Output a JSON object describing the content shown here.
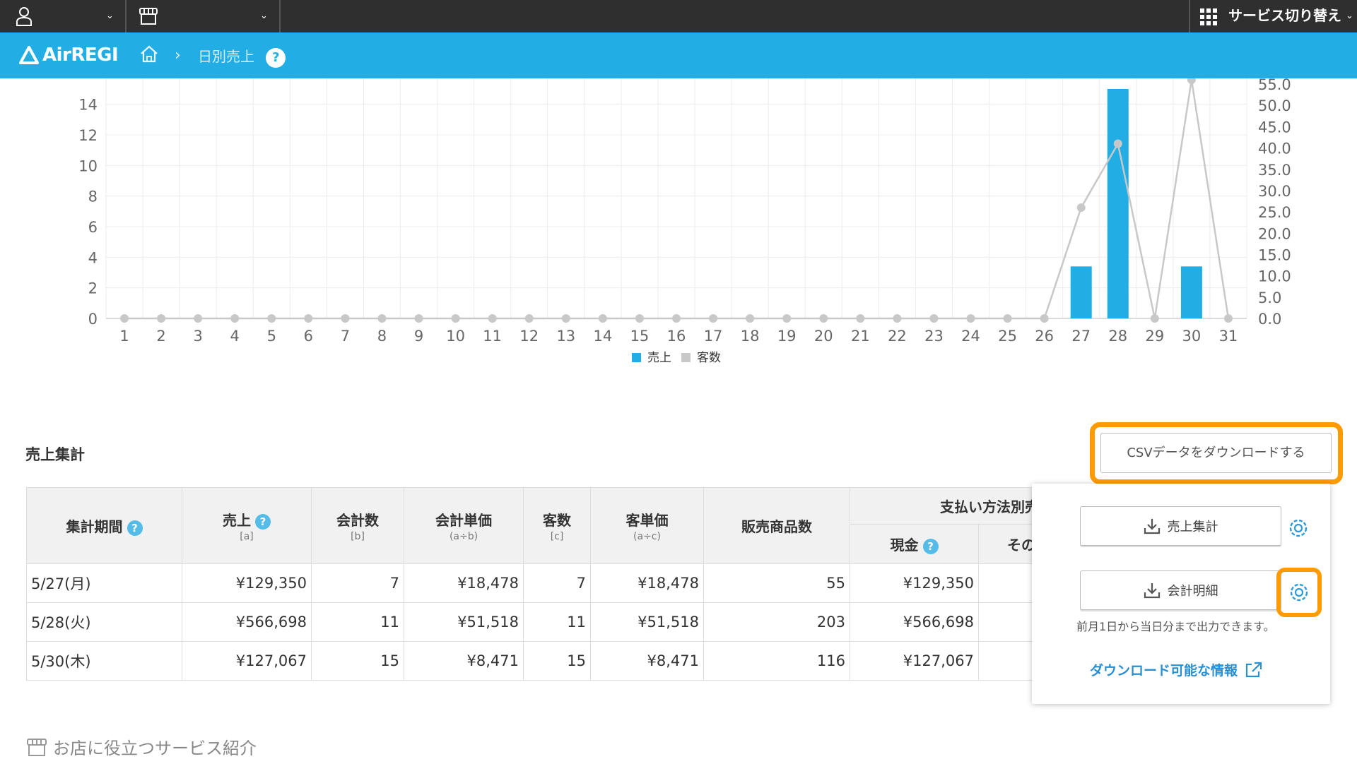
{
  "topbar": {
    "service_switch_label": "サービス切り替え"
  },
  "header": {
    "logo_text": "AirREGI",
    "breadcrumb_current": "日別売上",
    "help_mark": "?"
  },
  "chart_data": {
    "type": "bar",
    "categories": [
      "1",
      "2",
      "3",
      "4",
      "5",
      "6",
      "7",
      "8",
      "9",
      "10",
      "11",
      "12",
      "13",
      "14",
      "15",
      "16",
      "17",
      "18",
      "19",
      "20",
      "21",
      "22",
      "23",
      "24",
      "25",
      "26",
      "27",
      "28",
      "29",
      "30",
      "31"
    ],
    "series": [
      {
        "name": "売上",
        "kind": "bar",
        "axis": "left",
        "color": "#22aee4",
        "values": [
          0,
          0,
          0,
          0,
          0,
          0,
          0,
          0,
          0,
          0,
          0,
          0,
          0,
          0,
          0,
          0,
          0,
          0,
          0,
          0,
          0,
          0,
          0,
          0,
          0,
          0,
          3.4,
          15,
          0,
          3.4,
          0
        ]
      },
      {
        "name": "客数",
        "kind": "line",
        "axis": "right",
        "color": "#c8c8c8",
        "values": [
          0,
          0,
          0,
          0,
          0,
          0,
          0,
          0,
          0,
          0,
          0,
          0,
          0,
          0,
          0,
          0,
          0,
          0,
          0,
          0,
          0,
          0,
          0,
          0,
          0,
          0,
          26,
          41,
          0,
          56,
          0
        ]
      }
    ],
    "y_left_ticks": [
      "0",
      "2",
      "4",
      "6",
      "8",
      "10",
      "12",
      "14"
    ],
    "y_right_ticks": [
      "0.0",
      "5.0",
      "10.0",
      "15.0",
      "20.0",
      "25.0",
      "30.0",
      "35.0",
      "40.0",
      "45.0",
      "50.0",
      "55.0"
    ],
    "ylim_left": [
      0,
      15.6
    ],
    "ylim_right": [
      0,
      56
    ],
    "grid": true,
    "legend": "bottom-center"
  },
  "summary": {
    "title": "売上集計",
    "csv_button": "CSVデータをダウンロードする",
    "headers": {
      "period": "集計期間",
      "sales": "売上",
      "sales_sub": "[a]",
      "count": "会計数",
      "count_sub": "[b]",
      "unit_price": "会計単価",
      "unit_price_sub": "(a÷b)",
      "customers": "客数",
      "customers_sub": "[c]",
      "per_customer": "客単価",
      "per_customer_sub": "(a÷c)",
      "items_sold": "販売商品数",
      "by_payment": "支払い方法別売上",
      "cash": "現金",
      "other": "その"
    },
    "rows": [
      {
        "period": "5/27(月)",
        "sales": "¥129,350",
        "count": "7",
        "unit_price": "¥18,478",
        "customers": "7",
        "per_customer": "¥18,478",
        "items_sold": "55",
        "cash": "¥129,350"
      },
      {
        "period": "5/28(火)",
        "sales": "¥566,698",
        "count": "11",
        "unit_price": "¥51,518",
        "customers": "11",
        "per_customer": "¥51,518",
        "items_sold": "203",
        "cash": "¥566,698"
      },
      {
        "period": "5/30(木)",
        "sales": "¥127,067",
        "count": "15",
        "unit_price": "¥8,471",
        "customers": "15",
        "per_customer": "¥8,471",
        "items_sold": "116",
        "cash": "¥127,067"
      }
    ]
  },
  "popup": {
    "btn_sales_summary": "売上集計",
    "btn_account_detail": "会計明細",
    "note": "前月1日から当日分まで出力できます。",
    "link": "ダウンロード可能な情報"
  },
  "footer": {
    "services_label": "お店に役立つサービス紹介"
  }
}
